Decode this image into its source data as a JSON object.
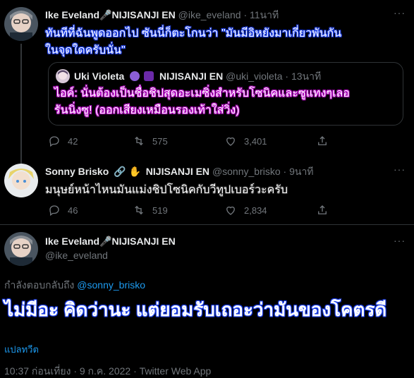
{
  "tweet1": {
    "name": "Ike Eveland🎤NIJISANJI EN",
    "handle": "@ike_eveland",
    "time": "· 11นาที",
    "text_line1": "ทันทีที่ฉันพูดออกไป ซันนี่ก็ตะโกนว่า \"มันมีอิหยังมาเกี่ยวพันกัน",
    "text_line2": "ในจุดใดครับนั่น\"",
    "quote": {
      "name": "Uki Violeta",
      "suffix": "NIJISANJI EN",
      "handle": "@uki_violeta",
      "time": "· 13นาที",
      "text_line1": "ไอค์: นั่นต้องเป็นชื่อชิปสุดอะเมซิ่งสำหรับโซนิคและซูแทงๆเลอ",
      "text_line2": "รันนิ่งซู! (ออกเสียงเหมือนรองเท้าใส่วิ่ง)"
    },
    "replies": "42",
    "retweets": "575",
    "likes": "3,401"
  },
  "tweet2": {
    "name": "Sonny Brisko",
    "suffix": "NIJISANJI EN",
    "handle": "@sonny_brisko",
    "time": "· 9นาที",
    "text": "มนุษย์หน้าไหนมันแม่งชิปโซนิคกับวีทูปเบอร์วะครับ",
    "replies": "46",
    "retweets": "519",
    "likes": "2,834"
  },
  "main": {
    "name": "Ike Eveland🎤NIJISANJI EN",
    "handle": "@ike_eveland",
    "replying_prefix": "กำลังตอบกลับถึง",
    "replying_to": "@sonny_brisko",
    "text": "ไม่มีอะ คิดว่านะ แต่ยอมรับเถอะว่ามันของโคตรดี",
    "translate": "แปลทวีต",
    "timestamp": "10:37 ก่อนเที่ยง · 9 ก.ค. 2022 · Twitter Web App"
  },
  "more_label": "···",
  "colors": {
    "background": "#000000",
    "muted": "#71767b",
    "link": "#1d9bf0",
    "blue_outline": "#1b3ee8",
    "purple_outline": "#b800c8"
  }
}
